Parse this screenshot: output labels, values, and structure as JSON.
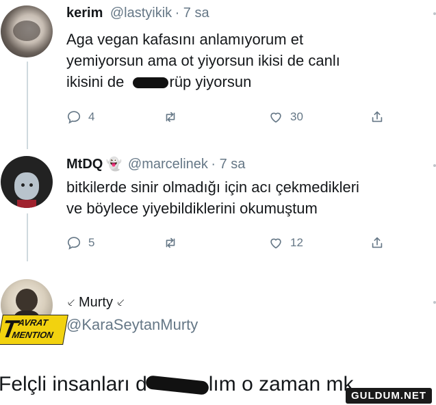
{
  "tweets": [
    {
      "name": "kerim",
      "handle": "@lastyikik",
      "time": "· 7 sa",
      "line1": "Aga vegan kafasını anlamıyorum et",
      "line2": "yemiyorsun ama ot yiyorsun ikisi de canlı",
      "line3_a": "ikisini de",
      "line3_b": "rüp yiyorsun",
      "reply_count": "4",
      "like_count": "30"
    },
    {
      "name": "MtDQ",
      "emoji": "👻",
      "handle": "@marcelinek",
      "time": "· 7 sa",
      "line1": "bitkilerde sinir olmadığı için acı çekmedikleri",
      "line2": "ve böylece yiyebildiklerini okumuştum",
      "reply_count": "5",
      "like_count": "12"
    },
    {
      "name": "Murty",
      "name_deco": "⸔",
      "handle": "@KaraSeytanMurty",
      "badge_line1": "AVRAT",
      "badge_line2": "MENTION",
      "badge_prefix": "T"
    }
  ],
  "reply": {
    "text_a": "Felçli insanları d",
    "text_b": "lım o zaman mk"
  },
  "watermark": "GULDUM.NET",
  "icons": {
    "reply": "reply-icon",
    "retweet": "retweet-icon",
    "like": "heart-icon",
    "share": "share-icon"
  }
}
